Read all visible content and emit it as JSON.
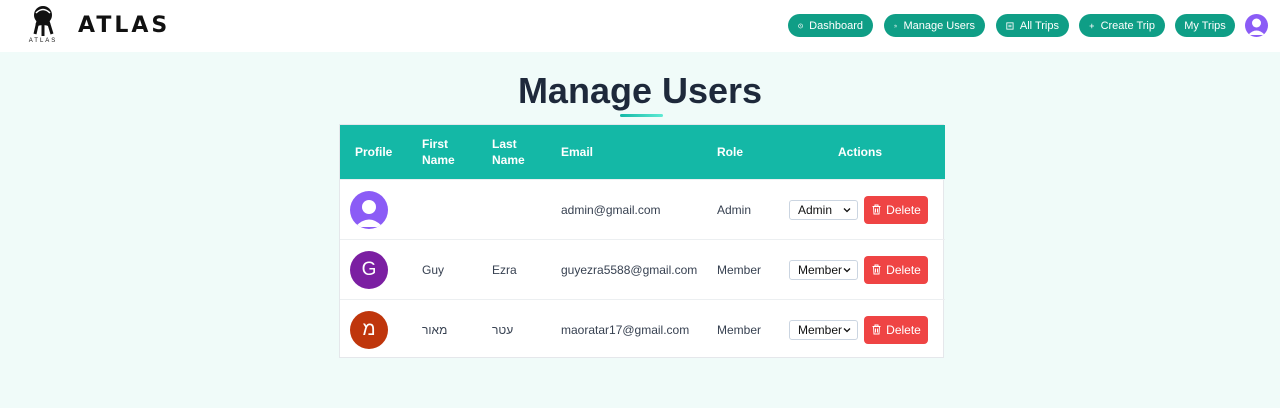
{
  "brand": {
    "name": "ATLAS",
    "logo_subtext": "ATLAS"
  },
  "nav": {
    "dashboard": "Dashboard",
    "manage_users": "Manage Users",
    "all_trips": "All Trips",
    "create_trip": "Create Trip",
    "my_trips": "My Trips"
  },
  "page": {
    "title": "Manage Users"
  },
  "table": {
    "headers": {
      "profile": "Profile",
      "first_name": "First Name",
      "last_name": "Last Name",
      "email": "Email",
      "role": "Role",
      "actions": "Actions"
    },
    "rows": [
      {
        "avatar_initial": "",
        "avatar_color": "#8b5cf6",
        "first_name": "",
        "last_name": "",
        "email": "admin@gmail.com",
        "role": "Admin",
        "role_select": "Admin",
        "delete_label": "Delete"
      },
      {
        "avatar_initial": "G",
        "avatar_color": "#7b1fa2",
        "first_name": "Guy",
        "last_name": "Ezra",
        "email": "guyezra5588@gmail.com",
        "role": "Member",
        "role_select": "Member",
        "delete_label": "Delete"
      },
      {
        "avatar_initial": "מ",
        "avatar_color": "#bf360c",
        "first_name": "מאור",
        "last_name": "עטר",
        "email": "maoratar17@gmail.com",
        "role": "Member",
        "role_select": "Member",
        "delete_label": "Delete"
      }
    ]
  },
  "colors": {
    "accent": "#14b8a6",
    "nav_button": "#0f9e86",
    "danger": "#ef4444",
    "avatar_default": "#8b5cf6"
  }
}
